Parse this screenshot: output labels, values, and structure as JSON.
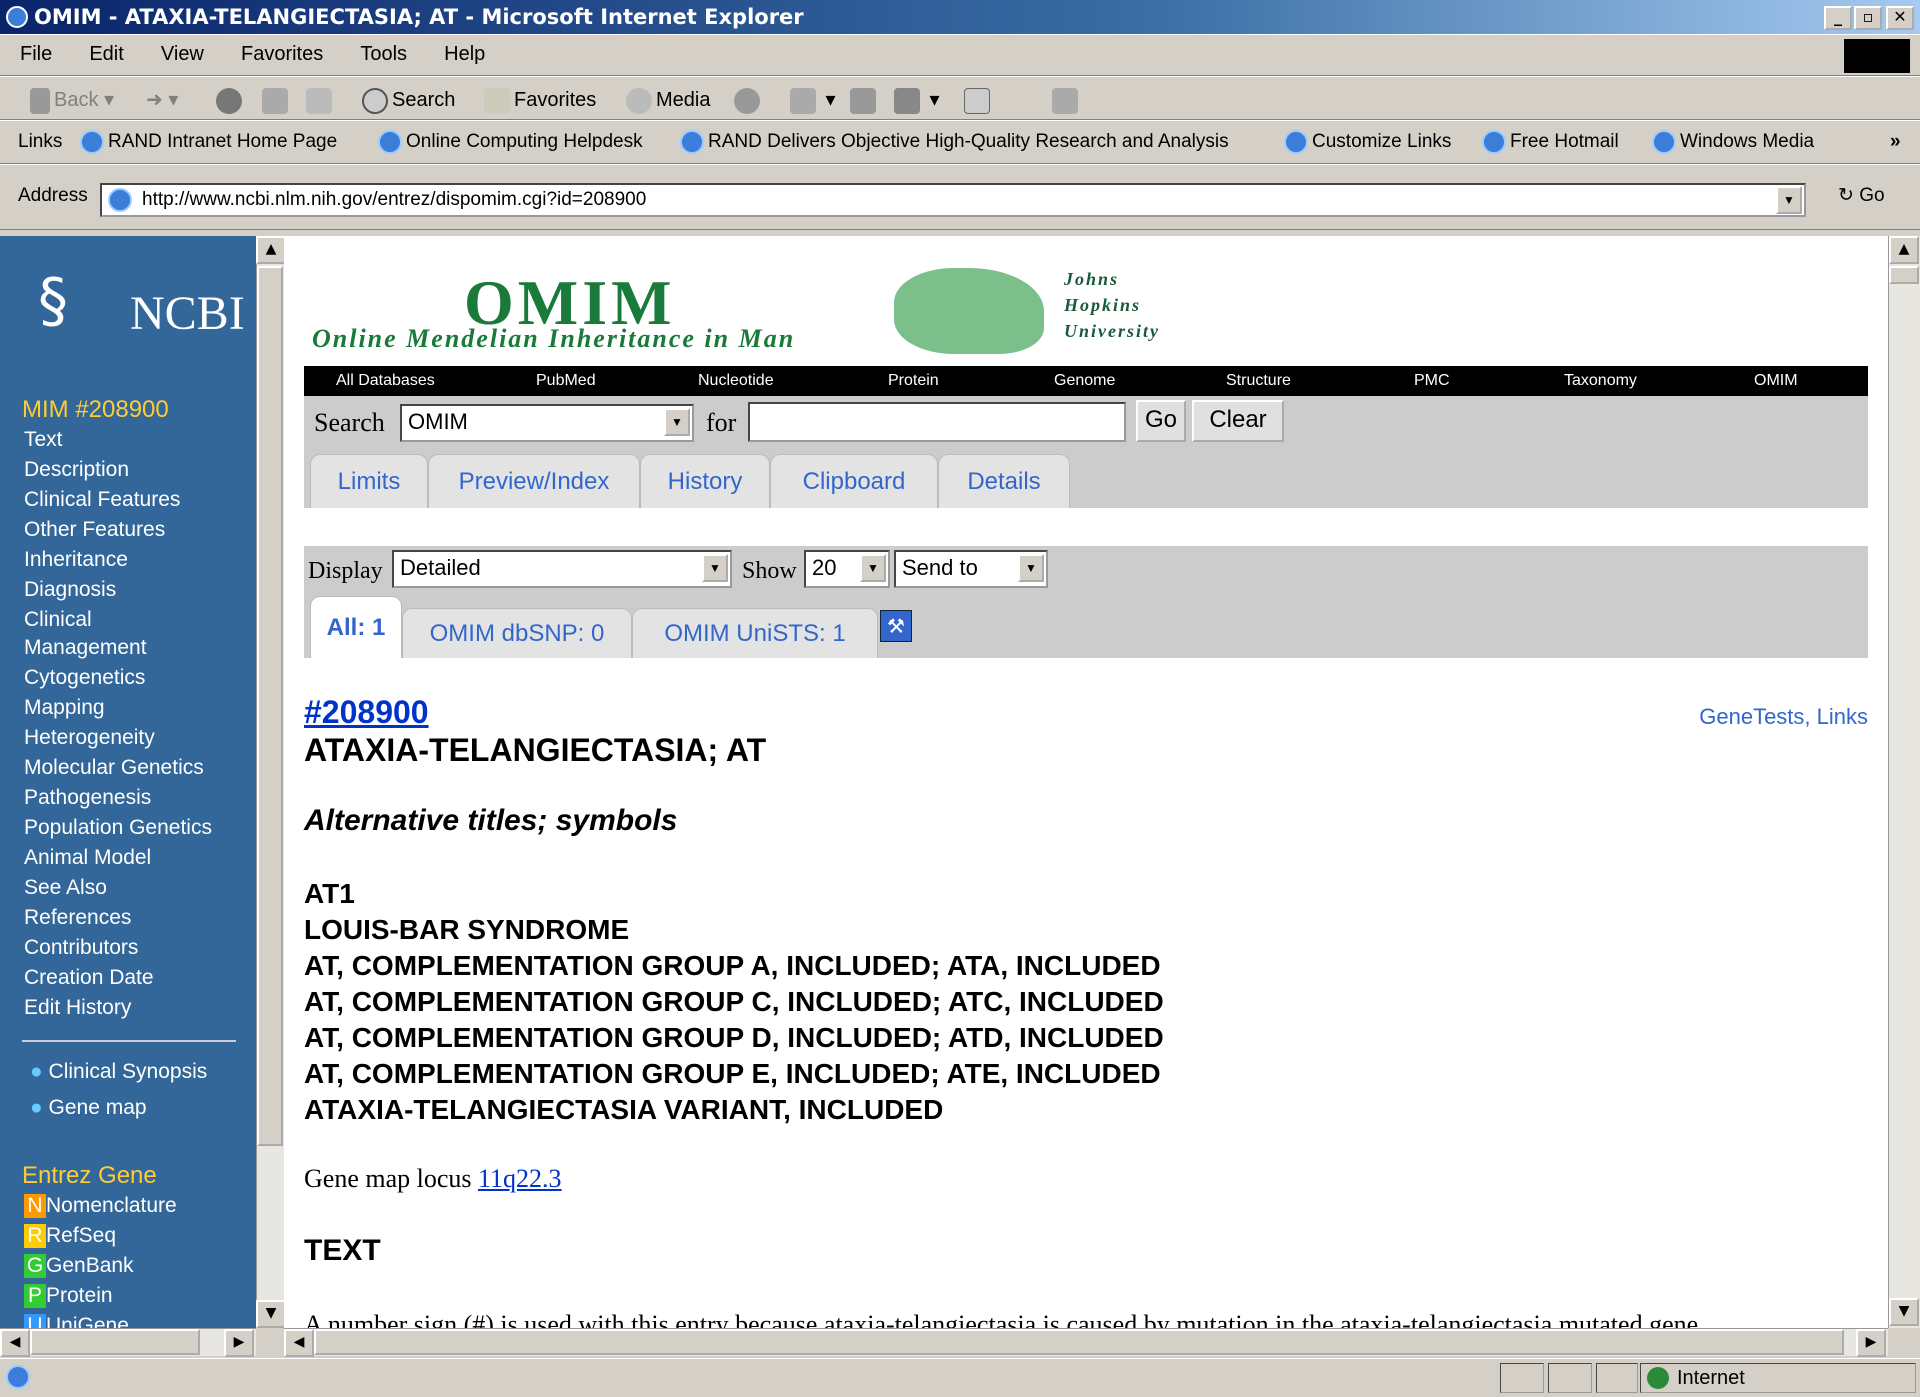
{
  "window": {
    "title": "OMIM - ATAXIA-TELANGIECTASIA; AT - Microsoft Internet Explorer"
  },
  "menu": [
    "File",
    "Edit",
    "View",
    "Favorites",
    "Tools",
    "Help"
  ],
  "toolbar": {
    "back": "Back",
    "search": "Search",
    "favorites": "Favorites",
    "media": "Media"
  },
  "links_bar": {
    "label": "Links",
    "items": [
      "RAND Intranet Home Page",
      "Online Computing Helpdesk",
      "RAND Delivers Objective High-Quality Research and Analysis",
      "Customize Links",
      "Free Hotmail",
      "Windows Media"
    ]
  },
  "address": {
    "label": "Address",
    "url": "http://www.ncbi.nlm.nih.gov/entrez/dispomim.cgi?id=208900",
    "go": "Go"
  },
  "sidebar": {
    "logo": "NCBI",
    "mim_heading": "MIM #208900",
    "links": [
      "Text",
      "Description",
      "Clinical Features",
      "Other Features",
      "Inheritance",
      "Diagnosis",
      "Clinical",
      "Management",
      "Cytogenetics",
      "Mapping",
      "Heterogeneity",
      "Molecular Genetics",
      "Pathogenesis",
      "Population Genetics",
      "Animal Model",
      "See Also",
      "References",
      "Contributors",
      "Creation Date",
      "Edit History"
    ],
    "bullets": [
      "Clinical Synopsis",
      "Gene map"
    ],
    "entrez_heading": "Entrez Gene",
    "entrez": [
      {
        "badge": "N",
        "label": "Nomenclature",
        "color": "#ff9900"
      },
      {
        "badge": "R",
        "label": "RefSeq",
        "color": "#ffcc00"
      },
      {
        "badge": "G",
        "label": "GenBank",
        "color": "#33cc33"
      },
      {
        "badge": "P",
        "label": "Protein",
        "color": "#33cc33"
      },
      {
        "badge": "U",
        "label": "UniGene",
        "color": "#3399ff"
      }
    ]
  },
  "banner": {
    "title": "OMIM",
    "subtitle": "Online Mendelian Inheritance in Man",
    "jhu": [
      "Johns",
      "Hopkins",
      "University"
    ]
  },
  "nav": [
    "All Databases",
    "PubMed",
    "Nucleotide",
    "Protein",
    "Genome",
    "Structure",
    "PMC",
    "Taxonomy",
    "OMIM"
  ],
  "search": {
    "label": "Search",
    "db": "OMIM",
    "for": "for",
    "go": "Go",
    "clear": "Clear"
  },
  "tabs": [
    "Limits",
    "Preview/Index",
    "History",
    "Clipboard",
    "Details"
  ],
  "display": {
    "label": "Display",
    "value": "Detailed",
    "show_label": "Show",
    "show_value": "20",
    "send_to": "Send to"
  },
  "result_tabs": [
    "All: 1",
    "OMIM dbSNP: 0",
    "OMIM UniSTS: 1"
  ],
  "entry": {
    "id": "#208900",
    "title": "ATAXIA-TELANGIECTASIA; AT",
    "links": "GeneTests, Links",
    "alt_heading": "Alternative titles; symbols",
    "alt_titles": [
      "AT1",
      "LOUIS-BAR SYNDROME",
      "AT, COMPLEMENTATION GROUP A, INCLUDED; ATA, INCLUDED",
      "AT, COMPLEMENTATION GROUP C, INCLUDED; ATC, INCLUDED",
      "AT, COMPLEMENTATION GROUP D, INCLUDED; ATD, INCLUDED",
      "AT, COMPLEMENTATION GROUP E, INCLUDED; ATE, INCLUDED",
      "ATAXIA-TELANGIECTASIA VARIANT, INCLUDED"
    ],
    "gene_map_label": "Gene map locus",
    "gene_map_locus": "11q22.3",
    "text_heading": "TEXT",
    "text_start": "A number sign (#) is used with this entry because ataxia-telangiectasia is caused by mutation in the ataxia-telangiectasia mutated gene"
  },
  "status": {
    "zone": "Internet"
  }
}
